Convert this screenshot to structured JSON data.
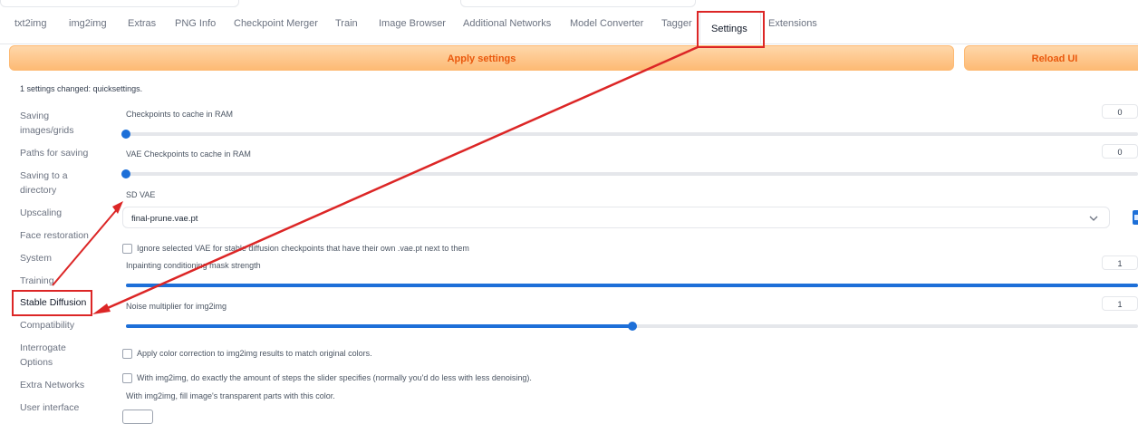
{
  "tabs": [
    {
      "label": "txt2img"
    },
    {
      "label": "img2img"
    },
    {
      "label": "Extras"
    },
    {
      "label": "PNG Info"
    },
    {
      "label": "Checkpoint Merger"
    },
    {
      "label": "Train"
    },
    {
      "label": "Image Browser"
    },
    {
      "label": "Additional Networks"
    },
    {
      "label": "Model Converter"
    },
    {
      "label": "Tagger"
    },
    {
      "label": "Settings"
    },
    {
      "label": "Extensions"
    }
  ],
  "active_tab": "Settings",
  "buttons": {
    "apply": "Apply settings",
    "reload": "Reload UI"
  },
  "status": "1 settings changed: quicksettings.",
  "sidebar": [
    {
      "label": "Saving images/grids"
    },
    {
      "label": "Paths for saving"
    },
    {
      "label": "Saving to a directory"
    },
    {
      "label": "Upscaling"
    },
    {
      "label": "Face restoration"
    },
    {
      "label": "System"
    },
    {
      "label": "Training"
    },
    {
      "label": "Stable Diffusion"
    },
    {
      "label": "Compatibility"
    },
    {
      "label": "Interrogate Options"
    },
    {
      "label": "Extra Networks"
    },
    {
      "label": "User interface"
    }
  ],
  "settings": {
    "ckpt_cache": {
      "label": "Checkpoints to cache in RAM",
      "value": "0",
      "fraction": 0
    },
    "vae_cache": {
      "label": "VAE Checkpoints to cache in RAM",
      "value": "0",
      "fraction": 0
    },
    "sd_vae": {
      "label": "SD VAE",
      "value": "final-prune.vae.pt"
    },
    "ignore_vae": {
      "label": "Ignore selected VAE for stable diffusion checkpoints that have their own .vae.pt next to them",
      "checked": false
    },
    "inpaint_mask": {
      "label": "Inpainting conditioning mask strength",
      "value": "1",
      "fraction": 1
    },
    "noise_mult": {
      "label": "Noise multiplier for img2img",
      "value": "1",
      "fraction": 0.5
    },
    "color_correction": {
      "label": "Apply color correction to img2img results to match original colors.",
      "checked": false
    },
    "exact_steps": {
      "label": "With img2img, do exactly the amount of steps the slider specifies (normally you'd do less with less denoising).",
      "checked": false
    },
    "fill_color": {
      "label": "With img2img, fill image's transparent parts with this color."
    }
  },
  "colors": {
    "accent": "#1d6fd8",
    "button_text": "#ea580c",
    "highlight": "#dc2626"
  }
}
